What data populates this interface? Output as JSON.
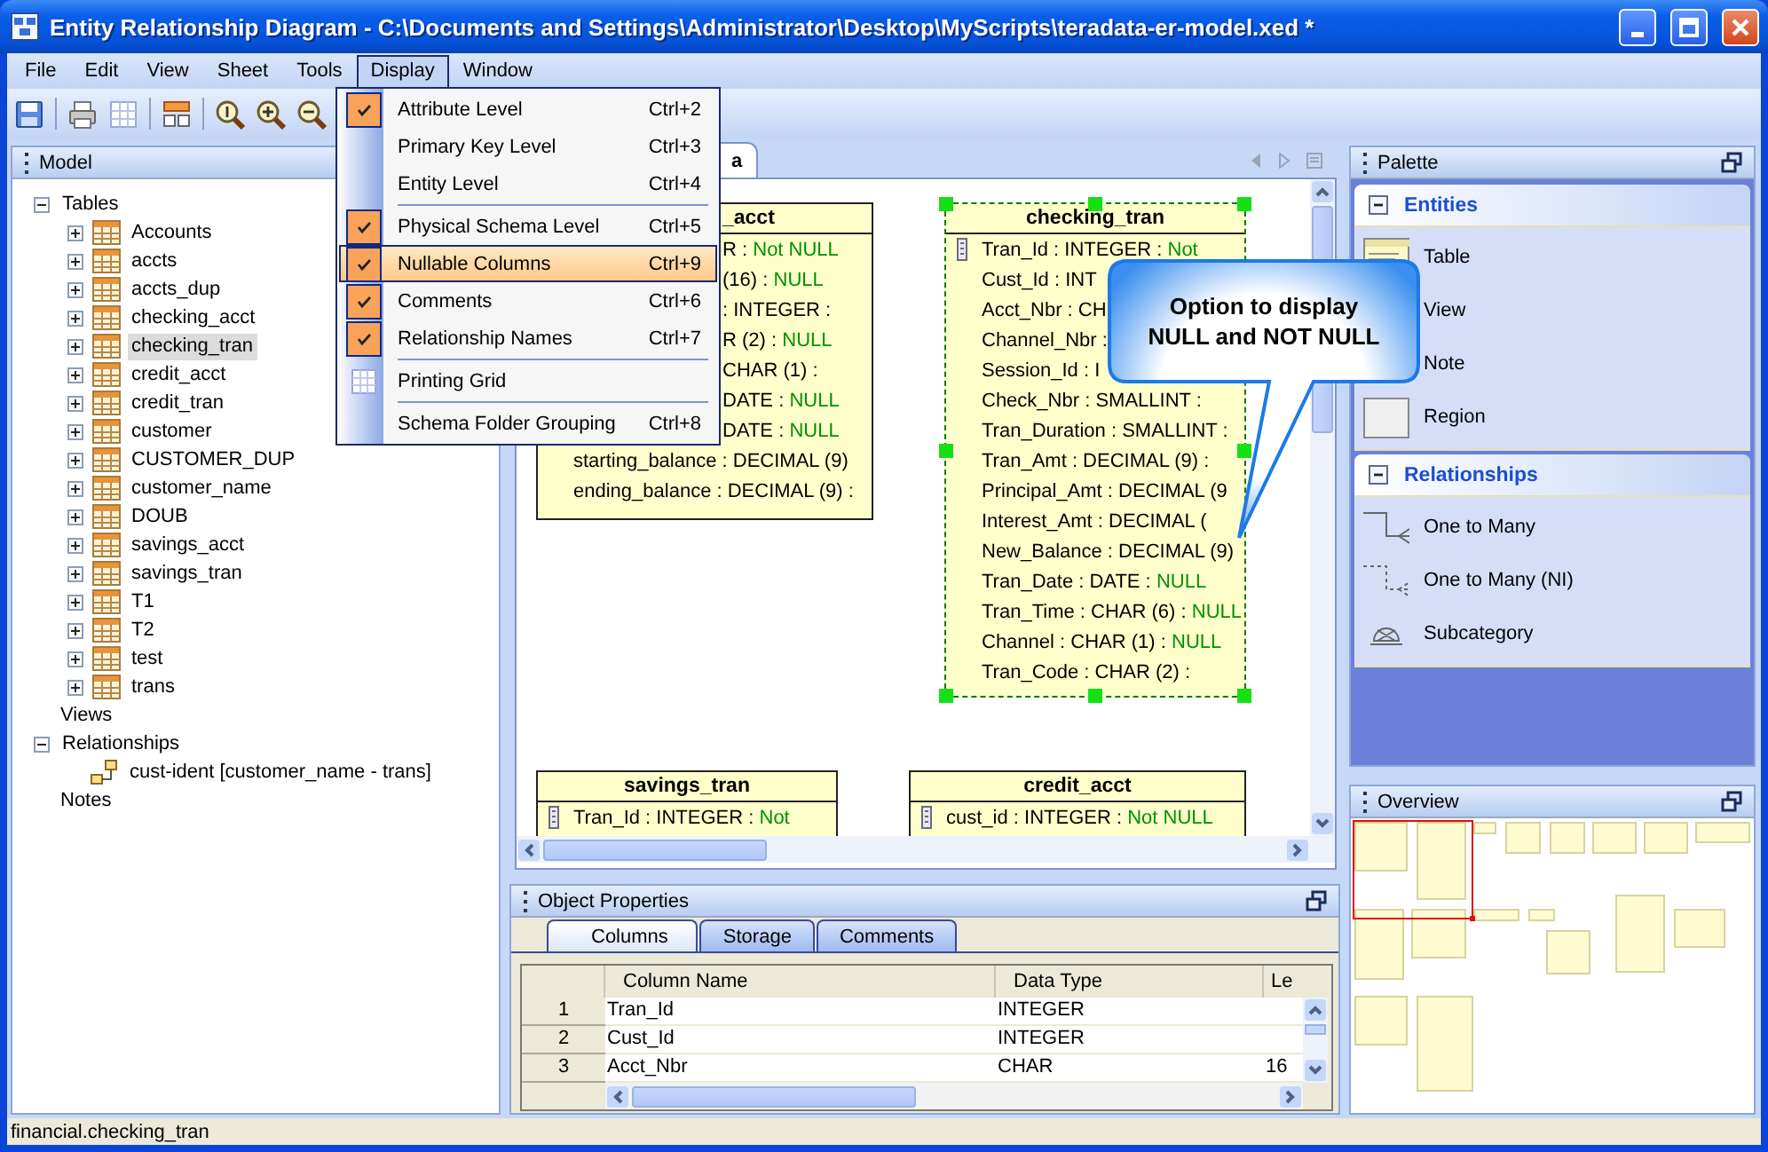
{
  "window": {
    "title": "Entity Relationship Diagram - C:\\Documents and Settings\\Administrator\\Desktop\\MyScripts\\teradata-er-model.xed *"
  },
  "menu_bar": [
    {
      "label": "File",
      "selected": false
    },
    {
      "label": "Edit",
      "selected": false
    },
    {
      "label": "View",
      "selected": false
    },
    {
      "label": "Sheet",
      "selected": false
    },
    {
      "label": "Tools",
      "selected": false
    },
    {
      "label": "Display",
      "selected": true
    },
    {
      "label": "Window",
      "selected": false
    }
  ],
  "display_menu": [
    {
      "kind": "toggle",
      "label": "Attribute Level",
      "shortcut": "Ctrl+2",
      "checked": true,
      "selected": false
    },
    {
      "kind": "toggle",
      "label": "Primary Key Level",
      "shortcut": "Ctrl+3",
      "checked": false,
      "selected": false
    },
    {
      "kind": "toggle",
      "label": "Entity Level",
      "shortcut": "Ctrl+4",
      "checked": false,
      "selected": false
    },
    {
      "kind": "separator"
    },
    {
      "kind": "toggle",
      "label": "Physical Schema Level",
      "shortcut": "Ctrl+5",
      "checked": true,
      "selected": false
    },
    {
      "kind": "toggle",
      "label": "Nullable Columns",
      "shortcut": "Ctrl+9",
      "checked": true,
      "selected": true
    },
    {
      "kind": "toggle",
      "label": "Comments",
      "shortcut": "Ctrl+6",
      "checked": true,
      "selected": false
    },
    {
      "kind": "toggle",
      "label": "Relationship Names",
      "shortcut": "Ctrl+7",
      "checked": true,
      "selected": false
    },
    {
      "kind": "separator"
    },
    {
      "kind": "grid",
      "label": "Printing Grid",
      "selected": false
    },
    {
      "kind": "separator"
    },
    {
      "kind": "toggle",
      "label": "Schema Folder Grouping",
      "shortcut": "Ctrl+8",
      "checked": false,
      "selected": false
    }
  ],
  "model_panel": {
    "title": "Model",
    "tree": [
      {
        "label": "Tables",
        "expanded": true,
        "selected": false,
        "children": [
          {
            "label": "Accounts",
            "kind": "table",
            "expanded": false,
            "selected": false
          },
          {
            "label": "accts",
            "kind": "table",
            "expanded": false,
            "selected": false
          },
          {
            "label": "accts_dup",
            "kind": "table",
            "expanded": false,
            "selected": false
          },
          {
            "label": "checking_acct",
            "kind": "table",
            "expanded": false,
            "selected": false
          },
          {
            "label": "checking_tran",
            "kind": "table",
            "expanded": false,
            "selected": true
          },
          {
            "label": "credit_acct",
            "kind": "table",
            "expanded": false,
            "selected": false
          },
          {
            "label": "credit_tran",
            "kind": "table",
            "expanded": false,
            "selected": false
          },
          {
            "label": "customer",
            "kind": "table",
            "expanded": false,
            "selected": false
          },
          {
            "label": "CUSTOMER_DUP",
            "kind": "table",
            "expanded": false,
            "selected": false
          },
          {
            "label": "customer_name",
            "kind": "table",
            "expanded": false,
            "selected": false
          },
          {
            "label": "DOUB",
            "kind": "table",
            "expanded": false,
            "selected": false
          },
          {
            "label": "savings_acct",
            "kind": "table",
            "expanded": false,
            "selected": false
          },
          {
            "label": "savings_tran",
            "kind": "table",
            "expanded": false,
            "selected": false
          },
          {
            "label": "T1",
            "kind": "table",
            "expanded": false,
            "selected": false
          },
          {
            "label": "T2",
            "kind": "table",
            "expanded": false,
            "selected": false
          },
          {
            "label": "test",
            "kind": "table",
            "expanded": false,
            "selected": false
          },
          {
            "label": "trans",
            "kind": "table",
            "expanded": false,
            "selected": false
          }
        ]
      },
      {
        "label": "Views",
        "selected": false
      },
      {
        "label": "Relationships",
        "expanded": true,
        "selected": false,
        "children": [
          {
            "label": "cust-ident [customer_name - trans]",
            "kind": "relationship",
            "selected": false
          }
        ]
      },
      {
        "label": "Notes",
        "selected": false
      }
    ]
  },
  "diagram": {
    "tab": {
      "label": "a",
      "selected": true
    },
    "entities": [
      {
        "name": "_acct",
        "covered": true,
        "selected": false,
        "rows": [
          {
            "text": "R :",
            "nullity": "Not NULL",
            "key": false,
            "covered": true
          },
          {
            "text": "(16) :",
            "nullity": "NULL",
            "key": false,
            "covered": true
          },
          {
            "text": ": INTEGER :",
            "key": false,
            "covered": true
          },
          {
            "text": "R (2) :",
            "nullity": "NULL",
            "key": false,
            "covered": true
          },
          {
            "text": "CHAR (1) :",
            "key": false,
            "covered": true
          },
          {
            "text": "DATE :",
            "nullity": "NULL",
            "key": false,
            "covered": true
          },
          {
            "text": "DATE :",
            "nullity": "NULL",
            "key": false,
            "covered": true
          },
          {
            "text": "starting_balance : DECIMAL (9)",
            "key": false,
            "covered": false
          },
          {
            "text": "ending_balance : DECIMAL (9) :",
            "key": false,
            "covered": false
          }
        ]
      },
      {
        "name": "checking_tran",
        "covered": false,
        "selected": true,
        "rows": [
          {
            "text": "Tran_Id : INTEGER :",
            "nullity": "Not",
            "key": true,
            "covered": false
          },
          {
            "text": "Cust_Id : INT",
            "key": false,
            "covered": false
          },
          {
            "text": "Acct_Nbr : CH",
            "key": false,
            "covered": false
          },
          {
            "text": "Channel_Nbr :",
            "key": false,
            "covered": false
          },
          {
            "text": "Session_Id : I",
            "key": false,
            "covered": false
          },
          {
            "text": "Check_Nbr : SMALLINT :",
            "key": false,
            "covered": false
          },
          {
            "text": "Tran_Duration : SMALLINT :",
            "key": false,
            "covered": false
          },
          {
            "text": "Tran_Amt : DECIMAL (9) :",
            "key": false,
            "covered": false
          },
          {
            "text": "Principal_Amt : DECIMAL (9",
            "key": false,
            "covered": false
          },
          {
            "text": "Interest_Amt : DECIMAL (",
            "key": false,
            "covered": false
          },
          {
            "text": "New_Balance : DECIMAL (9)",
            "key": false,
            "covered": false
          },
          {
            "text": "Tran_Date : DATE :",
            "nullity": "NULL",
            "key": false,
            "covered": false
          },
          {
            "text": "Tran_Time : CHAR (6) :",
            "nullity": "NULL",
            "key": false,
            "covered": false
          },
          {
            "text": "Channel : CHAR (1) :",
            "nullity": "NULL",
            "key": false,
            "covered": false
          },
          {
            "text": "Tran_Code : CHAR (2) :",
            "key": false,
            "covered": false
          }
        ]
      },
      {
        "name": "savings_tran",
        "covered": false,
        "selected": false,
        "rows": [
          {
            "text": "Tran_Id : INTEGER :",
            "nullity": "Not",
            "key": true,
            "covered": false
          }
        ]
      },
      {
        "name": "credit_acct",
        "covered": false,
        "selected": false,
        "rows": [
          {
            "text": "cust_id : INTEGER :",
            "nullity": "Not NULL",
            "key": true,
            "covered": false
          }
        ]
      }
    ],
    "callout": "Option to display\nNULL and NOT NULL"
  },
  "palette": {
    "title": "Palette",
    "sections": [
      {
        "title": "Entities",
        "expanded": true,
        "items": [
          {
            "label": "Table",
            "kind": "table"
          },
          {
            "label": "View",
            "kind": "view"
          },
          {
            "label": "Note",
            "kind": "note"
          },
          {
            "label": "Region",
            "kind": "region"
          }
        ]
      },
      {
        "title": "Relationships",
        "expanded": true,
        "items": [
          {
            "label": "One to Many",
            "kind": "one-to-many"
          },
          {
            "label": "One to Many (NI)",
            "kind": "one-to-many-ni"
          },
          {
            "label": "Subcategory",
            "kind": "subcategory"
          }
        ]
      }
    ]
  },
  "overview": {
    "title": "Overview"
  },
  "properties": {
    "title": "Object Properties",
    "tabs": [
      {
        "label": "Columns",
        "selected": true
      },
      {
        "label": "Storage",
        "selected": false
      },
      {
        "label": "Comments",
        "selected": false
      }
    ],
    "columns": [
      "Column Name",
      "Data Type",
      "Le"
    ],
    "rows": [
      {
        "number": "1",
        "column_name": "Tran_Id",
        "data_type": "INTEGER"
      },
      {
        "number": "2",
        "column_name": "Cust_Id",
        "data_type": "INTEGER"
      },
      {
        "number": "3",
        "column_name": "Acct_Nbr",
        "data_type": "CHAR",
        "length": "16"
      }
    ]
  },
  "status_bar": "financial.checking_tran"
}
